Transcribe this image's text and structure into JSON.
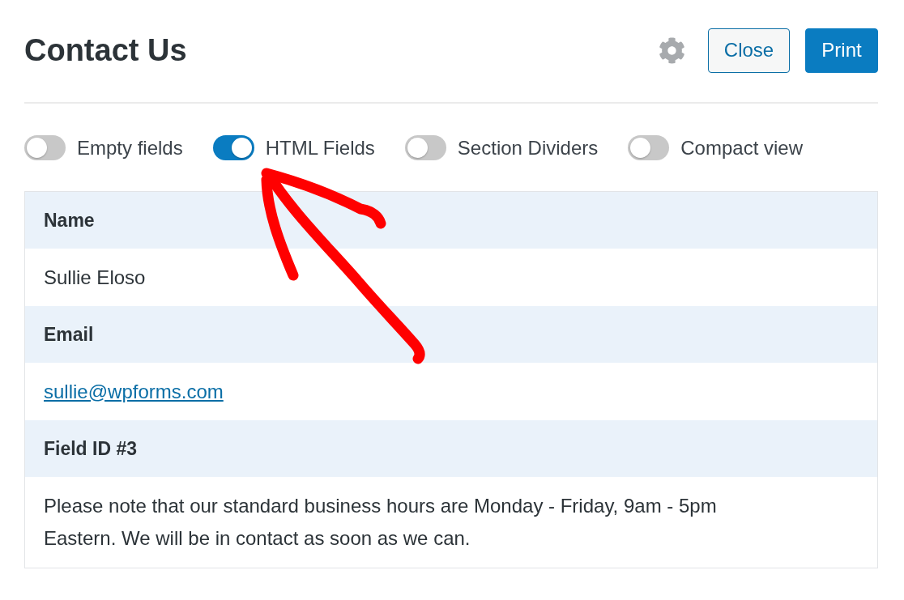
{
  "header": {
    "title": "Contact Us",
    "buttons": [
      {
        "label": "Close",
        "kind": "secondary"
      },
      {
        "label": "Print",
        "kind": "primary"
      }
    ]
  },
  "toggles": [
    {
      "label": "Empty fields",
      "on": false
    },
    {
      "label": "HTML Fields",
      "on": true
    },
    {
      "label": "Section Dividers",
      "on": false
    },
    {
      "label": "Compact view",
      "on": false
    }
  ],
  "entry_fields": [
    {
      "label": "Name",
      "value": "Sullie Eloso",
      "kind": "text"
    },
    {
      "label": "Email",
      "value": "sullie@wpforms.com",
      "kind": "link"
    },
    {
      "label": "Field ID #3",
      "value": "Please note that our standard business hours are Monday - Friday, 9am - 5pm Eastern. We will be in contact as soon as we can.",
      "kind": "text"
    }
  ]
}
